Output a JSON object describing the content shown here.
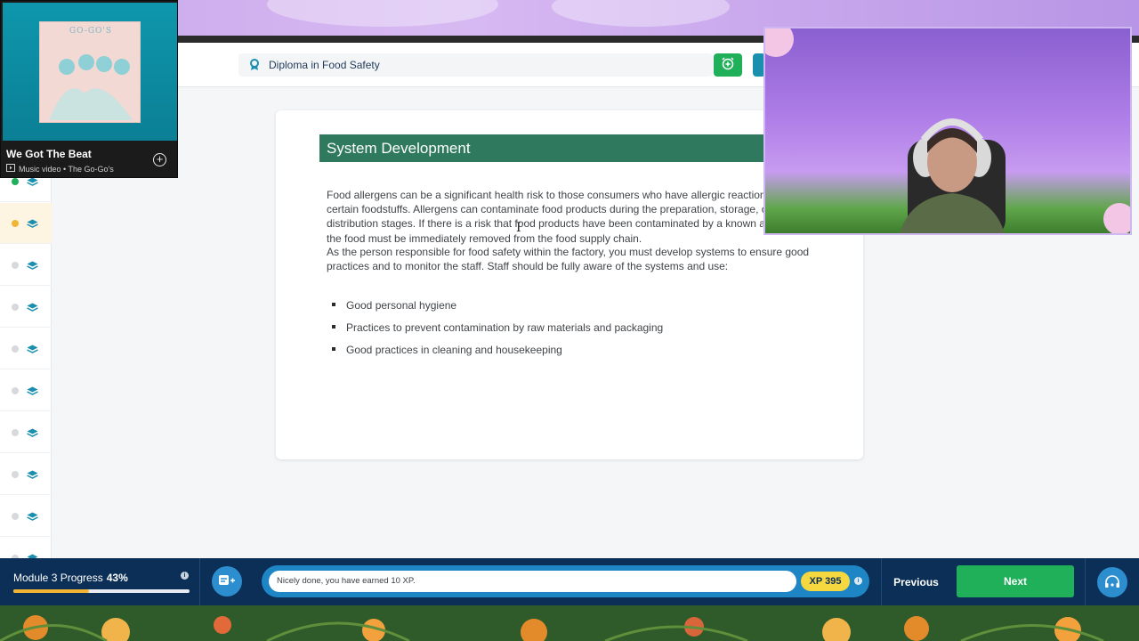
{
  "header": {
    "course_title": "Diploma in Food Safety",
    "icons": [
      "award-ribbon-icon",
      "alarm-clock-plus-icon",
      "menu-icon"
    ]
  },
  "sidebar": {
    "items": [
      {
        "status": "complete",
        "icon": "layers-icon"
      },
      {
        "status": "current",
        "icon": "layers-icon"
      },
      {
        "status": "pending",
        "icon": "layers-icon"
      },
      {
        "status": "pending",
        "icon": "layers-icon"
      },
      {
        "status": "pending",
        "icon": "layers-icon"
      },
      {
        "status": "pending",
        "icon": "layers-icon"
      },
      {
        "status": "pending",
        "icon": "layers-icon"
      },
      {
        "status": "pending",
        "icon": "layers-icon"
      },
      {
        "status": "pending",
        "icon": "layers-icon"
      },
      {
        "status": "pending",
        "icon": "layers-icon"
      }
    ]
  },
  "content": {
    "section_title": "System Development",
    "paragraph1": "Food allergens can be a significant health risk to those consumers who have allergic reactions to certain foodstuffs. Allergens can contaminate food products during the preparation, storage, or distribution stages. If there is a risk that food products have been contaminated by a known allergen, the food must be immediately removed from the food supply chain.",
    "paragraph2": "As the person responsible for food safety within the factory, you must develop systems to ensure good practices and to monitor the staff. Staff should be fully aware of the systems and use:",
    "bullets": [
      "Good personal hygiene",
      "Practices to prevent contamination by raw materials and packaging",
      "Good practices in cleaning and housekeeping"
    ]
  },
  "video_overlay": {
    "album_text": "GO-GO'S",
    "song_title": "We Got The Beat",
    "meta": "Music video • The Go-Go's"
  },
  "bottom_bar": {
    "progress_label": "Module 3 Progress",
    "progress_percent_text": "43%",
    "progress_value": 0.43,
    "message": "Nicely done, you have earned 10 XP.",
    "xp_badge": "XP 395",
    "previous_label": "Previous",
    "next_label": "Next"
  },
  "colors": {
    "navy": "#0b2f57",
    "green_header": "#2f7a5e",
    "next_green": "#20b05a",
    "xp_yellow": "#f5d840",
    "progress_yellow": "#f2b533",
    "accent_teal": "#1a8fae"
  }
}
